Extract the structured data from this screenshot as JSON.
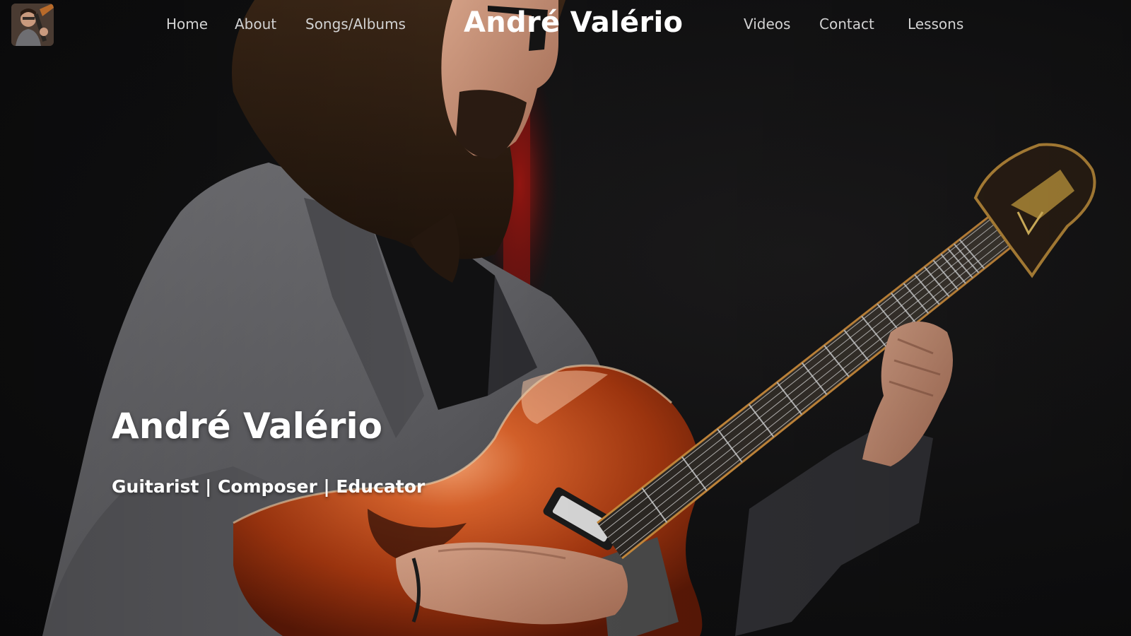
{
  "header": {
    "logo_alt": "André Valério",
    "brand": "André Valério",
    "nav_left": [
      "Home",
      "About",
      "Songs/Albums"
    ],
    "nav_right": [
      "Videos",
      "Contact",
      "Lessons"
    ]
  },
  "hero": {
    "title": "André Valério",
    "subtitle": "Guitarist | Composer | Educator",
    "image_subject": "guitarist-playing-archtop-guitar"
  },
  "colors": {
    "background": "#0e0e0f",
    "text": "#ffffff",
    "nav_text": "#d2d2d2",
    "jacket": "#7c7c80",
    "guitar_body": "#b8441c",
    "stage_red": "#8e1410"
  }
}
